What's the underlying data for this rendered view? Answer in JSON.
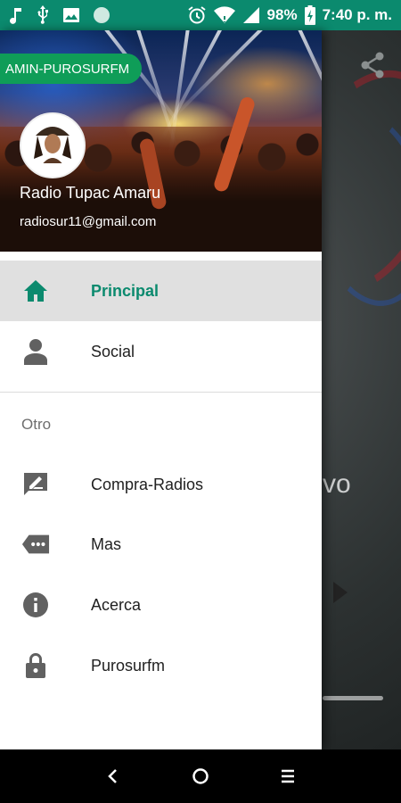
{
  "status_bar": {
    "battery_percent": "98%",
    "time": "7:40 p. m.",
    "left_icons": [
      "music-note-icon",
      "usb-icon",
      "image-icon",
      "circle-icon"
    ],
    "right_icons": [
      "alarm-icon",
      "wifi-icon",
      "signal-icon",
      "battery-icon"
    ]
  },
  "drawer": {
    "header": {
      "badge": "AMIN-PUROSURFM",
      "name": "Radio Tupac Amaru",
      "email": "radiosur11@gmail.com"
    },
    "menu": [
      {
        "label": "Principal",
        "icon": "home-icon",
        "active": true
      },
      {
        "label": "Social",
        "icon": "person-icon",
        "active": false
      }
    ],
    "section_title": "Otro",
    "other_menu": [
      {
        "label": "Compra-Radios",
        "icon": "rate-review-icon"
      },
      {
        "label": "Mas",
        "icon": "more-label-icon"
      },
      {
        "label": "Acerca",
        "icon": "info-icon"
      },
      {
        "label": "Purosurfm",
        "icon": "lock-icon"
      }
    ]
  },
  "background": {
    "partial_text": "vo"
  },
  "colors": {
    "status_bar": "#0b8a6e",
    "accent": "#0b8a6e",
    "badge": "#0f9d58",
    "active_item_bg": "#e0e0e0",
    "icon_gray": "#616161"
  }
}
